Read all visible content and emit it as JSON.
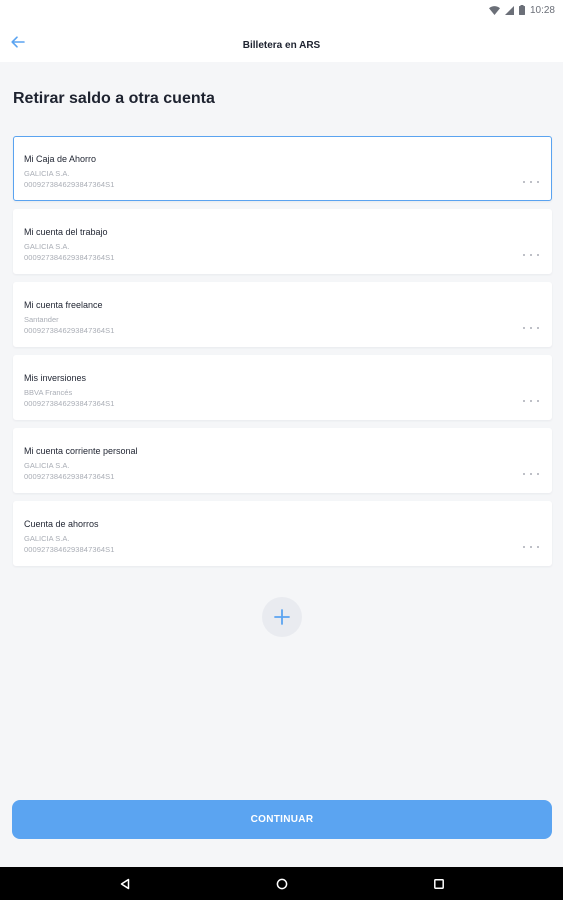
{
  "status_bar": {
    "time": "10:28",
    "icons": [
      "wifi-icon",
      "cellular-signal-icon",
      "battery-icon"
    ]
  },
  "app_bar": {
    "back_icon": "arrow-left-icon",
    "title": "Billetera en ARS"
  },
  "main": {
    "page_title": "Retirar saldo a otra cuenta",
    "accounts": [
      {
        "name": "Mi Caja de Ahorro",
        "bank": "GALICIA S.A.",
        "number": "0009273846293847364S1",
        "selected": true
      },
      {
        "name": "Mi cuenta del trabajo",
        "bank": "GALICIA S.A.",
        "number": "0009273846293847364S1",
        "selected": false
      },
      {
        "name": "Mi cuenta freelance",
        "bank": "Santander",
        "number": "0009273846293847364S1",
        "selected": false
      },
      {
        "name": "Mis inversiones",
        "bank": "BBVA Francés",
        "number": "0009273846293847364S1",
        "selected": false
      },
      {
        "name": "Mi cuenta corriente personal",
        "bank": "GALICIA S.A.",
        "number": "0009273846293847364S1",
        "selected": false
      },
      {
        "name": "Cuenta de ahorros",
        "bank": "GALICIA S.A.",
        "number": "0009273846293847364S1",
        "selected": false
      }
    ],
    "add_icon": "plus-icon",
    "continue_label": "CONTINUAR"
  },
  "nav_bar": {
    "icons": [
      "back-triangle-icon",
      "home-circle-icon",
      "recents-square-icon"
    ]
  },
  "colors": {
    "accent": "#5ba4f1",
    "selected_border": "#5aa3f0",
    "background": "#f5f6f8",
    "card": "#ffffff",
    "muted_text": "#a9adb5",
    "primary_text": "#1e2330"
  }
}
